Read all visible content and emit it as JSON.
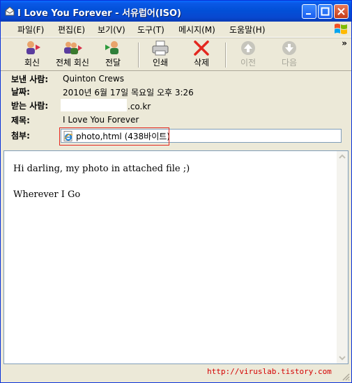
{
  "window": {
    "title": "I Love You Forever - 서유럽어(ISO)"
  },
  "menu": [
    {
      "label": "파일(F)"
    },
    {
      "label": "편집(E)"
    },
    {
      "label": "보기(V)"
    },
    {
      "label": "도구(T)"
    },
    {
      "label": "메시지(M)"
    },
    {
      "label": "도움말(H)"
    }
  ],
  "toolbar": {
    "reply": "회신",
    "reply_all": "전체 회신",
    "forward": "전달",
    "print": "인쇄",
    "delete": "삭제",
    "previous": "이전",
    "next": "다음",
    "overflow": "»"
  },
  "header": {
    "from_label": "보낸 사람:",
    "from_value": "Quinton Crews",
    "date_label": "날짜:",
    "date_value": "2010년 6월 17일 목요일 오후 3:26",
    "to_label": "받는 사람:",
    "to_domain": ".co.kr",
    "subject_label": "제목:",
    "subject_value": "I Love You Forever",
    "attach_label": "첨부:",
    "attach_value": "photo,html (438바이트)"
  },
  "message": {
    "line1": "Hi darling, my photo in attached file ;)",
    "line2": "Wherever I Go"
  },
  "status": {
    "link": "http://viruslab.tistory.com"
  },
  "colors": {
    "title_blue": "#0250d8",
    "highlight_red": "#e3271f",
    "watermark_red": "#d40000"
  }
}
